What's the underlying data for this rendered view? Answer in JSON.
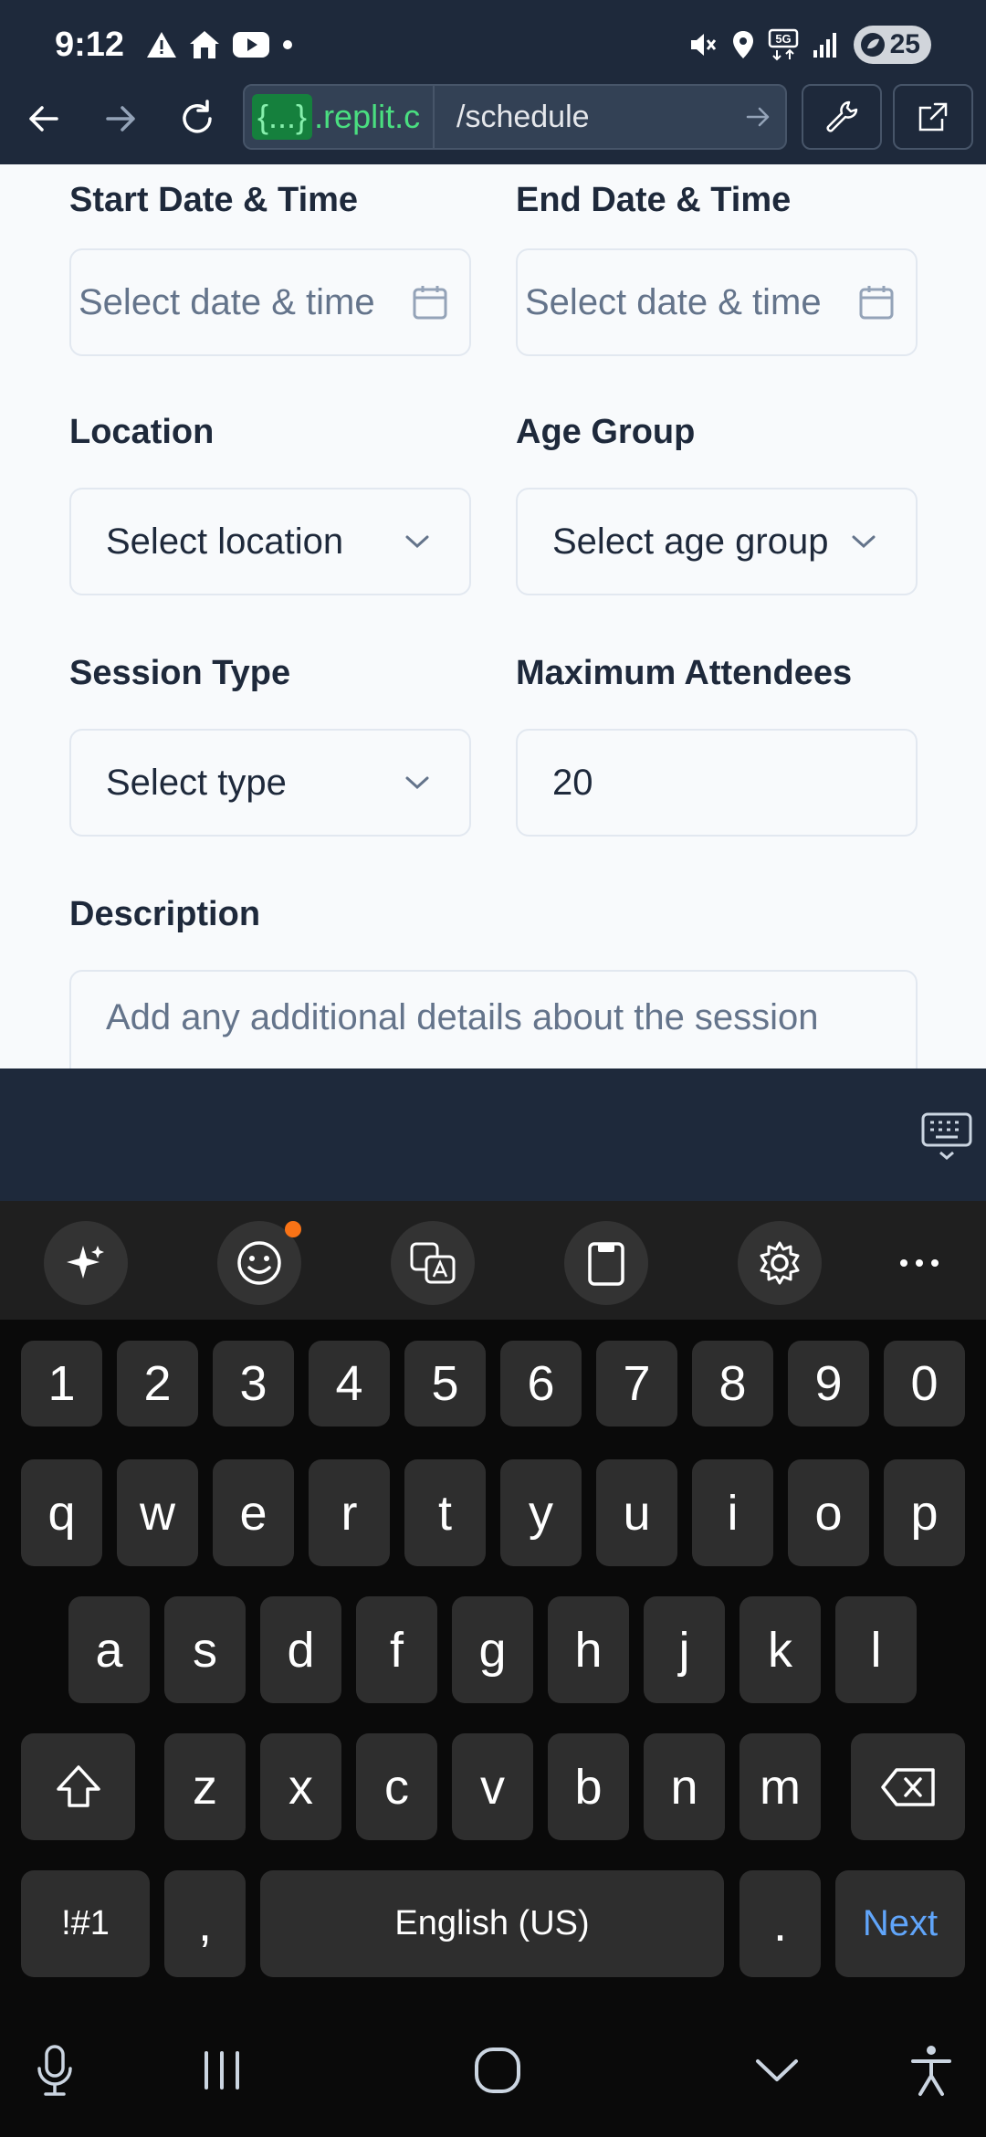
{
  "status_bar": {
    "time": "9:12",
    "battery": "25"
  },
  "browser": {
    "url_brace": "{...}",
    "url_host": ".replit.c",
    "url_path": "/schedule"
  },
  "form": {
    "start": {
      "label": "Start Date & Time",
      "placeholder": "Select date & time"
    },
    "end": {
      "label": "End Date & Time",
      "placeholder": "Select date & time"
    },
    "location": {
      "label": "Location",
      "placeholder": "Select location"
    },
    "age_group": {
      "label": "Age Group",
      "placeholder": "Select age group"
    },
    "session_type": {
      "label": "Session Type",
      "placeholder": "Select type"
    },
    "max_attendees": {
      "label": "Maximum Attendees",
      "value": "20"
    },
    "description": {
      "label": "Description",
      "placeholder": "Add any additional details about the session"
    }
  },
  "keyboard": {
    "row_numbers": [
      "1",
      "2",
      "3",
      "4",
      "5",
      "6",
      "7",
      "8",
      "9",
      "0"
    ],
    "row1": [
      "q",
      "w",
      "e",
      "r",
      "t",
      "y",
      "u",
      "i",
      "o",
      "p"
    ],
    "row2": [
      "a",
      "s",
      "d",
      "f",
      "g",
      "h",
      "j",
      "k",
      "l"
    ],
    "row3": [
      "z",
      "x",
      "c",
      "v",
      "b",
      "n",
      "m"
    ],
    "symbols_key": "!#1",
    "comma_key": ",",
    "space_label": "English (US)",
    "period_key": ".",
    "next_label": "Next"
  },
  "colors": {
    "accent_green": "#4ade80",
    "next_blue": "#60a5fa",
    "notification_dot": "#f97316"
  }
}
